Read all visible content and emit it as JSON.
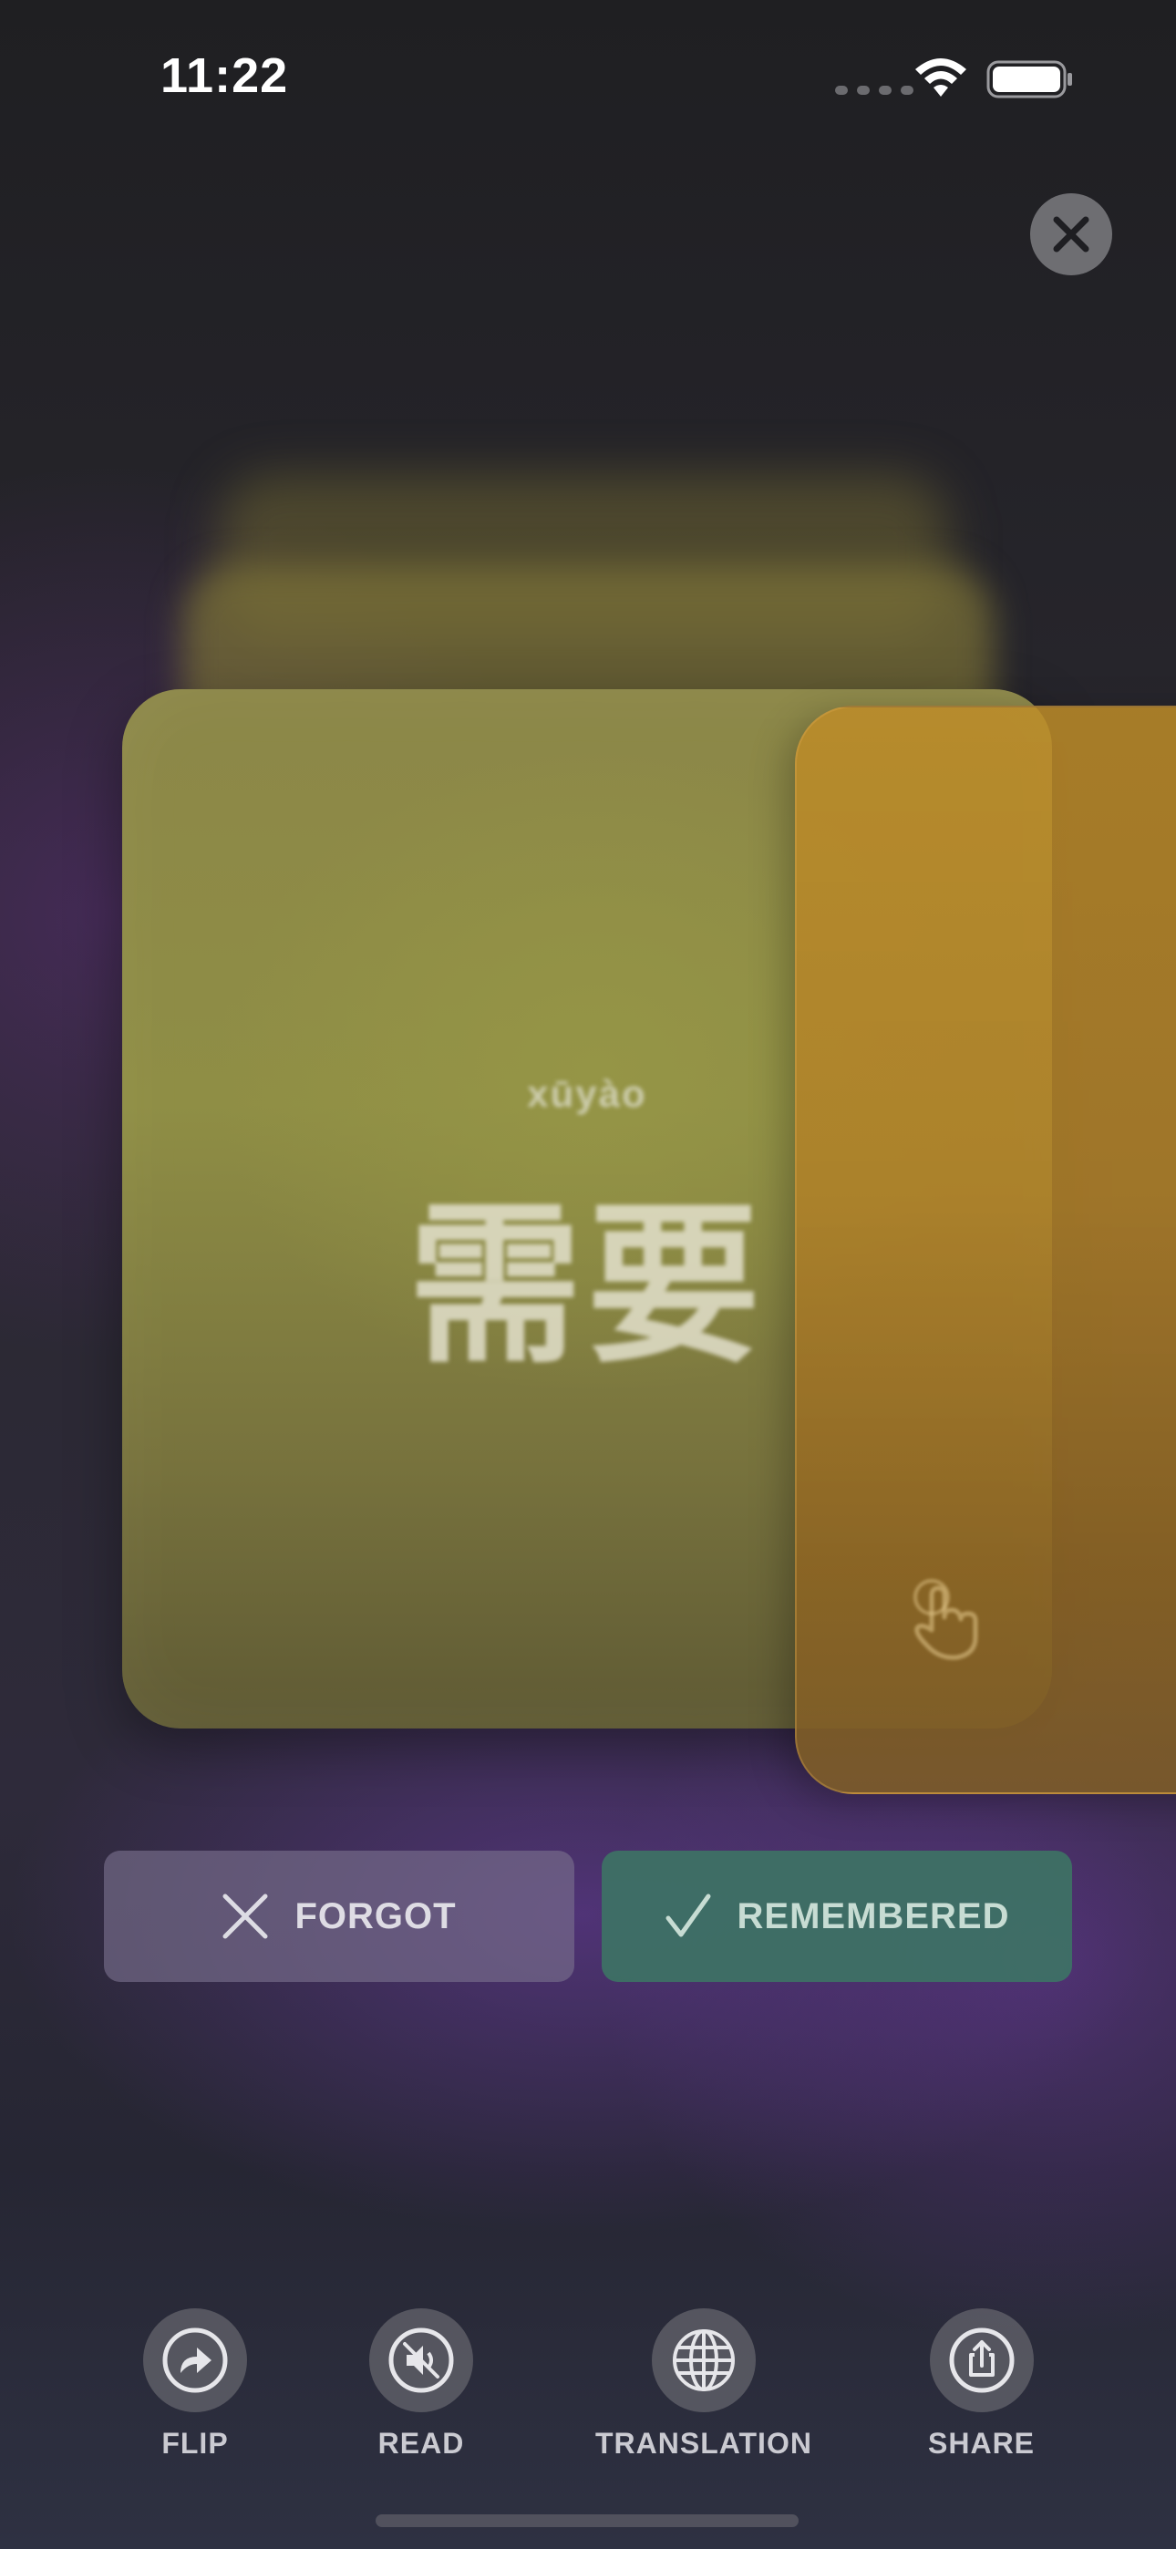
{
  "status_bar": {
    "time": "11:22",
    "icons": [
      "signal-dots",
      "wifi-icon",
      "battery-icon"
    ]
  },
  "close_button": {
    "icon": "close-icon"
  },
  "flashcard": {
    "pinyin": "xūyào",
    "hanzi": "需要",
    "hint_icon": "tap-hand-icon",
    "colors": {
      "front": "#8f8e45",
      "next_card": "#b38a2c"
    }
  },
  "actions": {
    "forgot_label": "FORGOT",
    "remembered_label": "REMEMBERED",
    "colors": {
      "forgot": "#6f6882",
      "remembered": "#3c7864"
    }
  },
  "toolbar": {
    "items": [
      {
        "label": "FLIP",
        "icon": "flip-icon"
      },
      {
        "label": "READ",
        "icon": "speaker-muted-icon"
      },
      {
        "label": "TRANSLATION",
        "icon": "globe-icon"
      },
      {
        "label": "SHARE",
        "icon": "share-icon"
      }
    ]
  }
}
